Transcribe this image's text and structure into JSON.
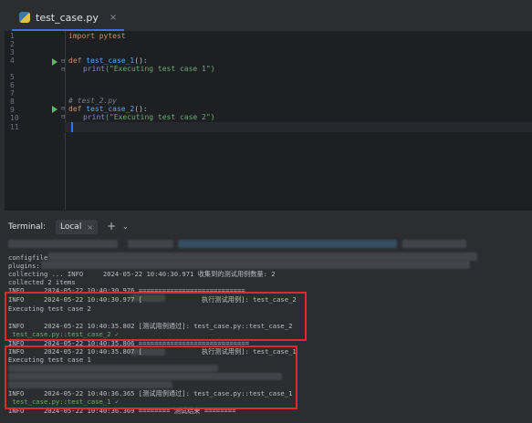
{
  "editor_tab": {
    "label": "test_case.py",
    "close": "×"
  },
  "gutter": {
    "line_numbers": [
      "1",
      "2",
      "3",
      "4",
      "5",
      "6",
      "7",
      "8",
      "9",
      "10",
      "11"
    ]
  },
  "code": {
    "line1": "import pytest",
    "l4_kw": "def ",
    "l4_fn": "test_case_1",
    "l4_rest": "():",
    "l5_bi": "print",
    "l5_str": "(\"Executing test case 1\")",
    "l8_comment": "# test_2.py",
    "l9_kw": "def ",
    "l9_fn": "test_case_2",
    "l9_rest": "():",
    "l10_bi": "print",
    "l10_str": "(\"Executing test case 2\")"
  },
  "terminal": {
    "title": "Terminal:",
    "tab": "Local",
    "tab_close": "×",
    "add": "+",
    "menu": "⌄",
    "lines": {
      "configfile": "configfile",
      "plugins": "plugins:",
      "collecting": "collecting ... INFO     2024-05-22 10:40:30.971 收集到的测试用例数量: 2",
      "collected": "collected 2 items",
      "sep1": "INFO     2024-05-22 10:40:30.976 ===========================",
      "info_start2": "INFO     2024-05-22 10:40:30.977 [               执行测试用例]: test_case_2",
      "exec2": "Executing test case 2",
      "pass2": "INFO     2024-05-22 10:40:35.802 [测试用例通过]: test_case.py::test_case_2",
      "result2": " test_case.py::test_case_2 ✓",
      "sep2": "INFO     2024-05-22 10:40:35.806 ============================",
      "info_start1": "INFO     2024-05-22 10:40:35.807 [               执行测试用例]: test_case_1",
      "exec1": "Executing test case 1",
      "pass1": "INFO     2024-05-22 10:40:36.365 [测试用例通过]: test_case.py::test_case_1",
      "result1": " test_case.py::test_case_1 ✓",
      "end": "INFO     2024-05-22 10:40:36.369 ======== 测试结束 ========"
    }
  },
  "icons": {
    "file": "python-file-icon",
    "run": "run-gutter-icon",
    "fold": "fold-icon"
  },
  "colors": {
    "highlight_box": "#e0282e",
    "accent": "#3574f0",
    "run_icon": "#5fb865"
  }
}
